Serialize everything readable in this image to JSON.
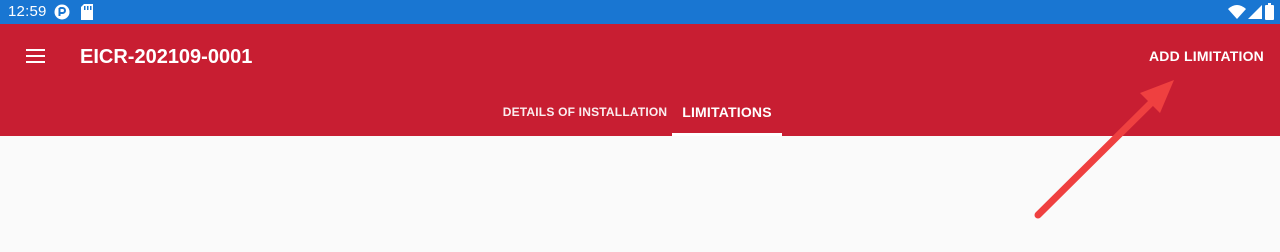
{
  "status_bar": {
    "time": "12:59",
    "left_icons": [
      "app-notification-icon",
      "sd-card-icon"
    ],
    "right_icons": [
      "wifi-icon",
      "cellular-signal-icon",
      "battery-icon"
    ],
    "color": "#1976d2"
  },
  "app_bar": {
    "title": "EICR-202109-0001",
    "action_label": "ADD LIMITATION",
    "color": "#c81e32"
  },
  "tabs": [
    {
      "label": "DETAILS OF INSTALLATION",
      "selected": false
    },
    {
      "label": "LIMITATIONS",
      "selected": true
    }
  ],
  "annotation": {
    "type": "arrow",
    "color": "#ef4040",
    "points_to": "add-limitation-button"
  }
}
